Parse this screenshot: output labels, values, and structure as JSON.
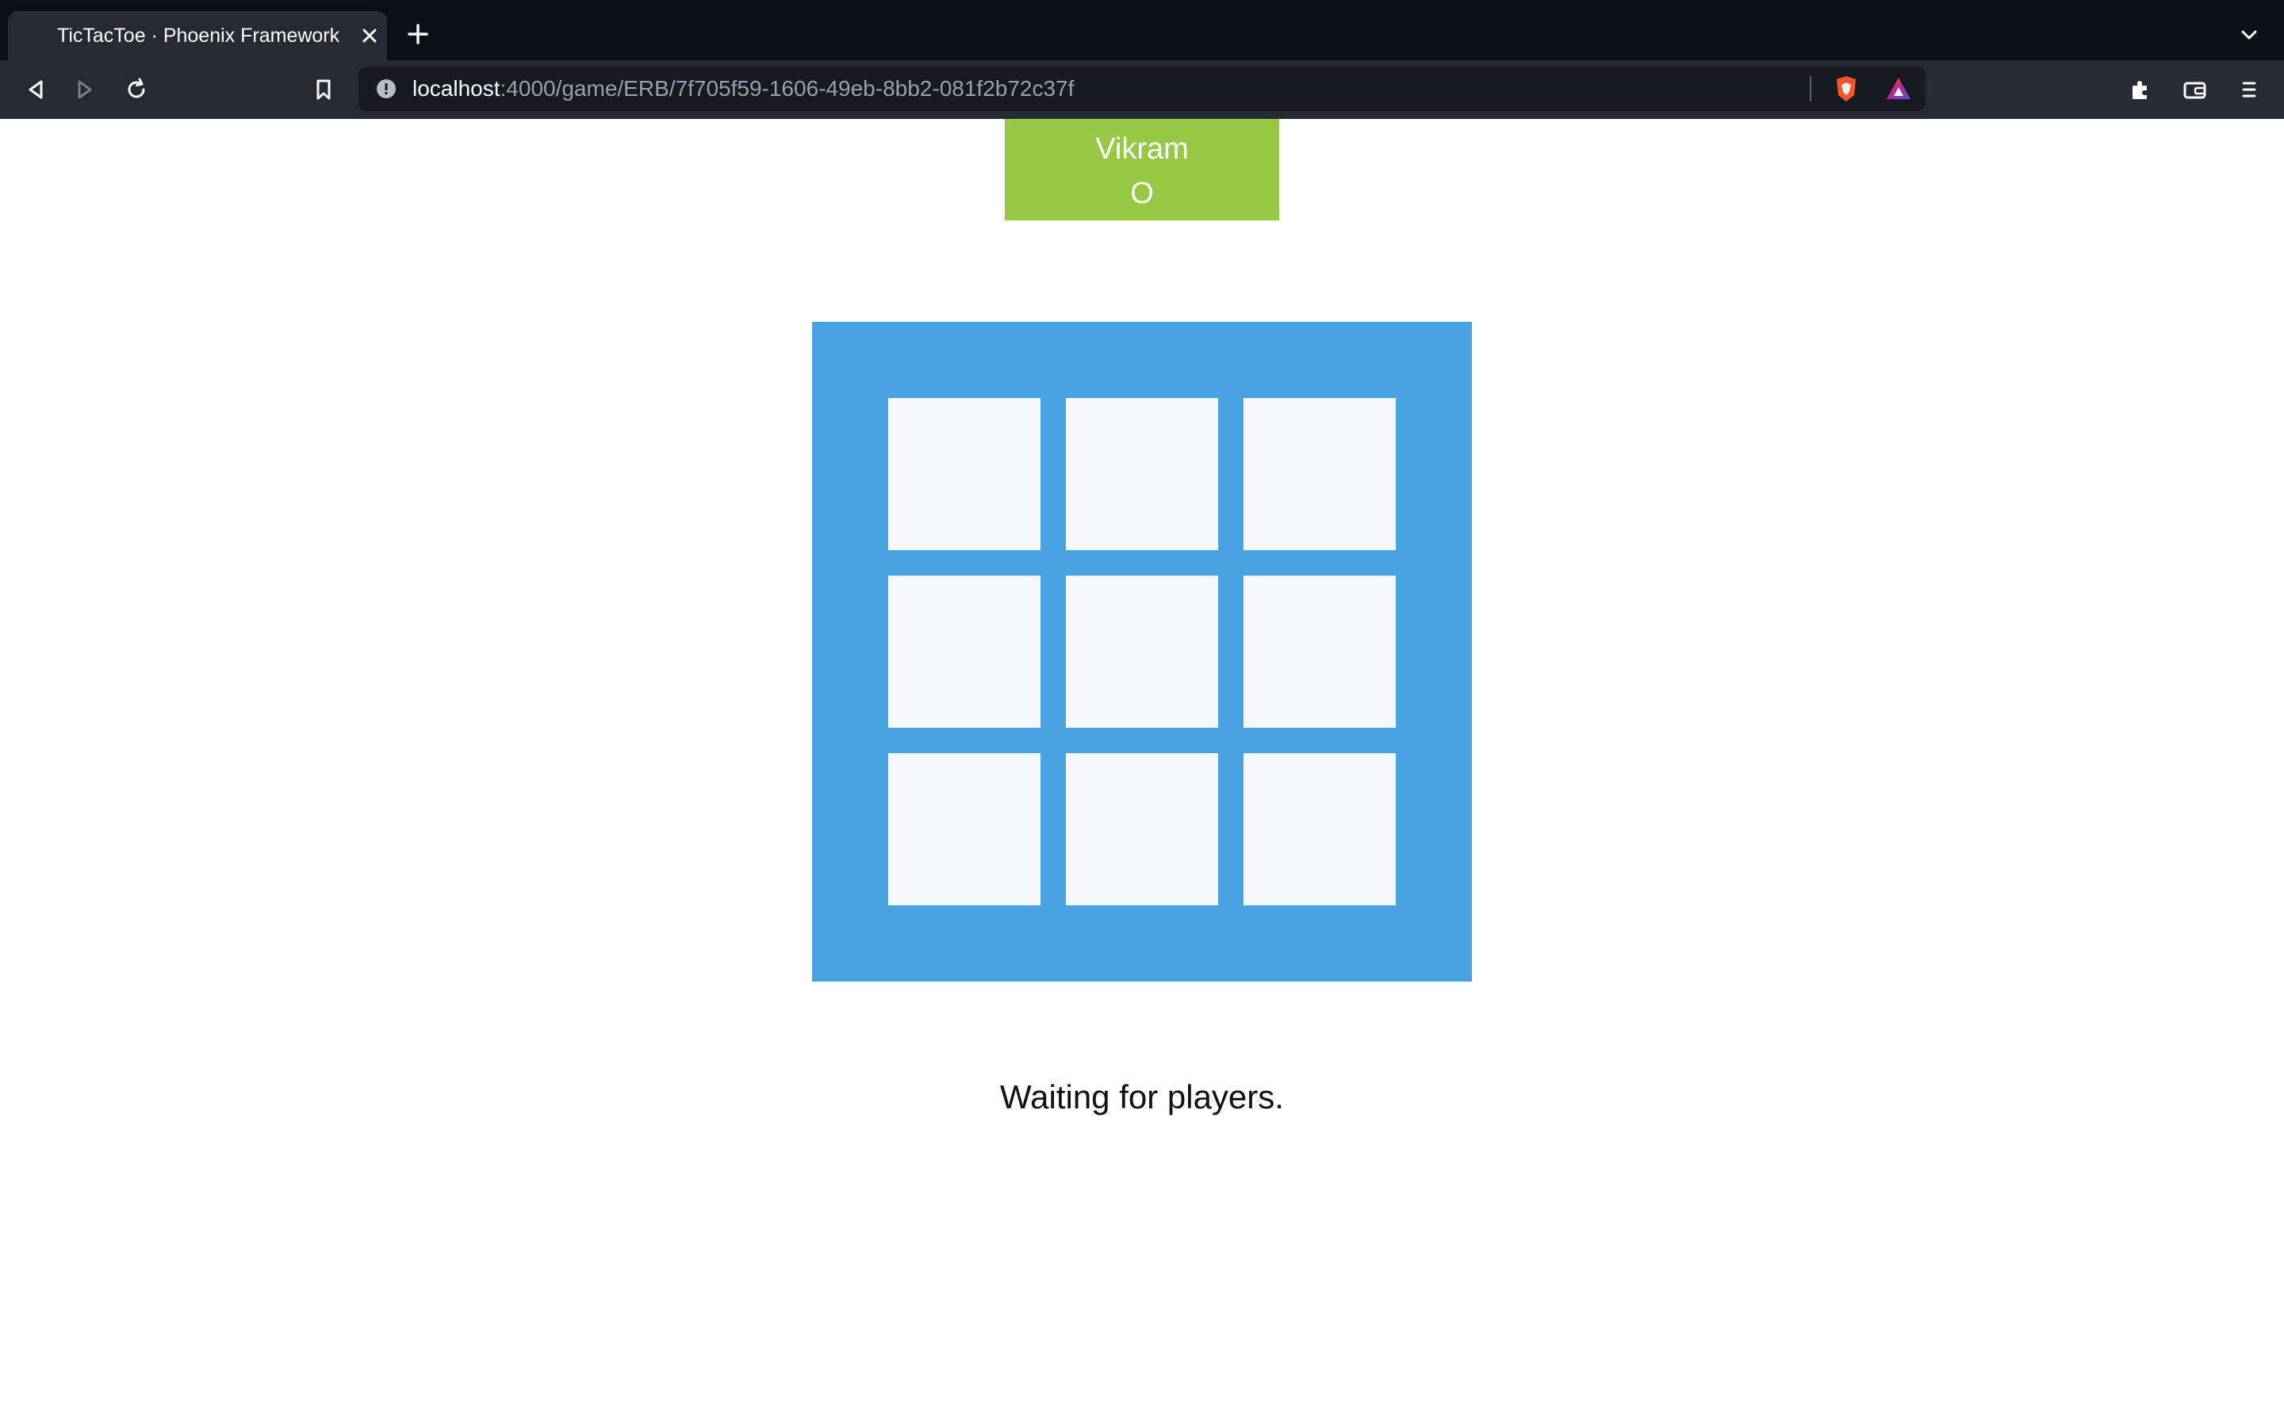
{
  "browser": {
    "tab": {
      "title": "TicTacToe · Phoenix Framework"
    },
    "address_bar": {
      "host": "localhost",
      "path": ":4000/game/ERB/7f705f59-1606-49eb-8bb2-081f2b72c37f"
    },
    "icons": [
      "close-icon",
      "plus-icon",
      "chevron-down-icon",
      "back-icon",
      "forward-icon",
      "reload-icon",
      "bookmark-icon",
      "info-icon",
      "brave-shield-icon",
      "brave-rewards-icon",
      "extensions-icon",
      "wallet-icon",
      "menu-icon"
    ]
  },
  "game": {
    "player": {
      "name": "Vikram",
      "symbol": "O",
      "color": "#97c946"
    },
    "board": {
      "color": "#4aa1e2",
      "cells": [
        "",
        "",
        "",
        "",
        "",
        "",
        "",
        "",
        ""
      ]
    },
    "status": "Waiting for players."
  }
}
